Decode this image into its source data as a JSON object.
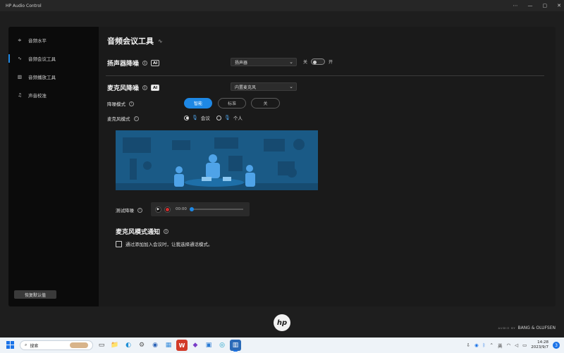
{
  "window": {
    "title": "HP Audio Control",
    "controls": [
      "⋯",
      "—",
      "▢",
      "✕"
    ]
  },
  "sidebar": {
    "items": [
      {
        "icon": "sliders-icon",
        "glyph": "≑",
        "label": "音频水平"
      },
      {
        "icon": "waveform-icon",
        "glyph": "∿",
        "label": "音频会议工具"
      },
      {
        "icon": "equalizer-icon",
        "glyph": "▥",
        "label": "音频播放工具"
      },
      {
        "icon": "music-note-icon",
        "glyph": "♫",
        "label": "声音校准"
      }
    ],
    "active_index": 1,
    "reset_label": "恢复默认值"
  },
  "main": {
    "title": "音频会议工具",
    "speaker": {
      "title": "扬声器降噪",
      "ai_badge": "AI",
      "device": "扬声器",
      "toggle_state": "关",
      "toggle_on_label": "开"
    },
    "mic": {
      "title": "麦克风降噪",
      "ai_badge": "AI",
      "device": "内置麦克风",
      "mode_label": "降噪模式",
      "modes": [
        "智能",
        "标准",
        "关"
      ],
      "selected_mode": 0,
      "mic_mode_label": "麦克风模式",
      "mic_modes": [
        "会议",
        "个人"
      ],
      "selected_mic_mode": 0
    },
    "test": {
      "label": "测试降噪",
      "time": "00:00",
      "progress": 0
    },
    "notify": {
      "title": "麦克风模式通知",
      "checkbox_label": "通过添加加入会议时，让我选择通话模式。",
      "checked": false
    }
  },
  "branding": {
    "logo": "hp",
    "audio_by": "AUDIO BY",
    "brand": "BANG & OLUFSEN"
  },
  "taskbar": {
    "search_placeholder": "搜索",
    "apps": [
      {
        "name": "task-view-icon",
        "glyph": "▭"
      },
      {
        "name": "file-explorer-icon",
        "glyph": "📁"
      },
      {
        "name": "edge-icon",
        "glyph": "◐"
      },
      {
        "name": "settings-icon",
        "glyph": "⚙"
      },
      {
        "name": "camera-icon",
        "glyph": "◉"
      },
      {
        "name": "photos-icon",
        "glyph": "▦"
      },
      {
        "name": "wps-icon",
        "glyph": "W"
      },
      {
        "name": "app-icon",
        "glyph": "◆"
      },
      {
        "name": "store-icon",
        "glyph": "▣"
      },
      {
        "name": "browser-icon",
        "glyph": "◎"
      },
      {
        "name": "audio-control-icon",
        "glyph": "▥"
      }
    ],
    "tray": {
      "lang": "英",
      "time": "14:28",
      "date": "2023/9/7",
      "notifications": "3"
    }
  },
  "colors": {
    "accent": "#1e88e5",
    "record": "#d32f2f",
    "illustration": "#1a5a86"
  }
}
